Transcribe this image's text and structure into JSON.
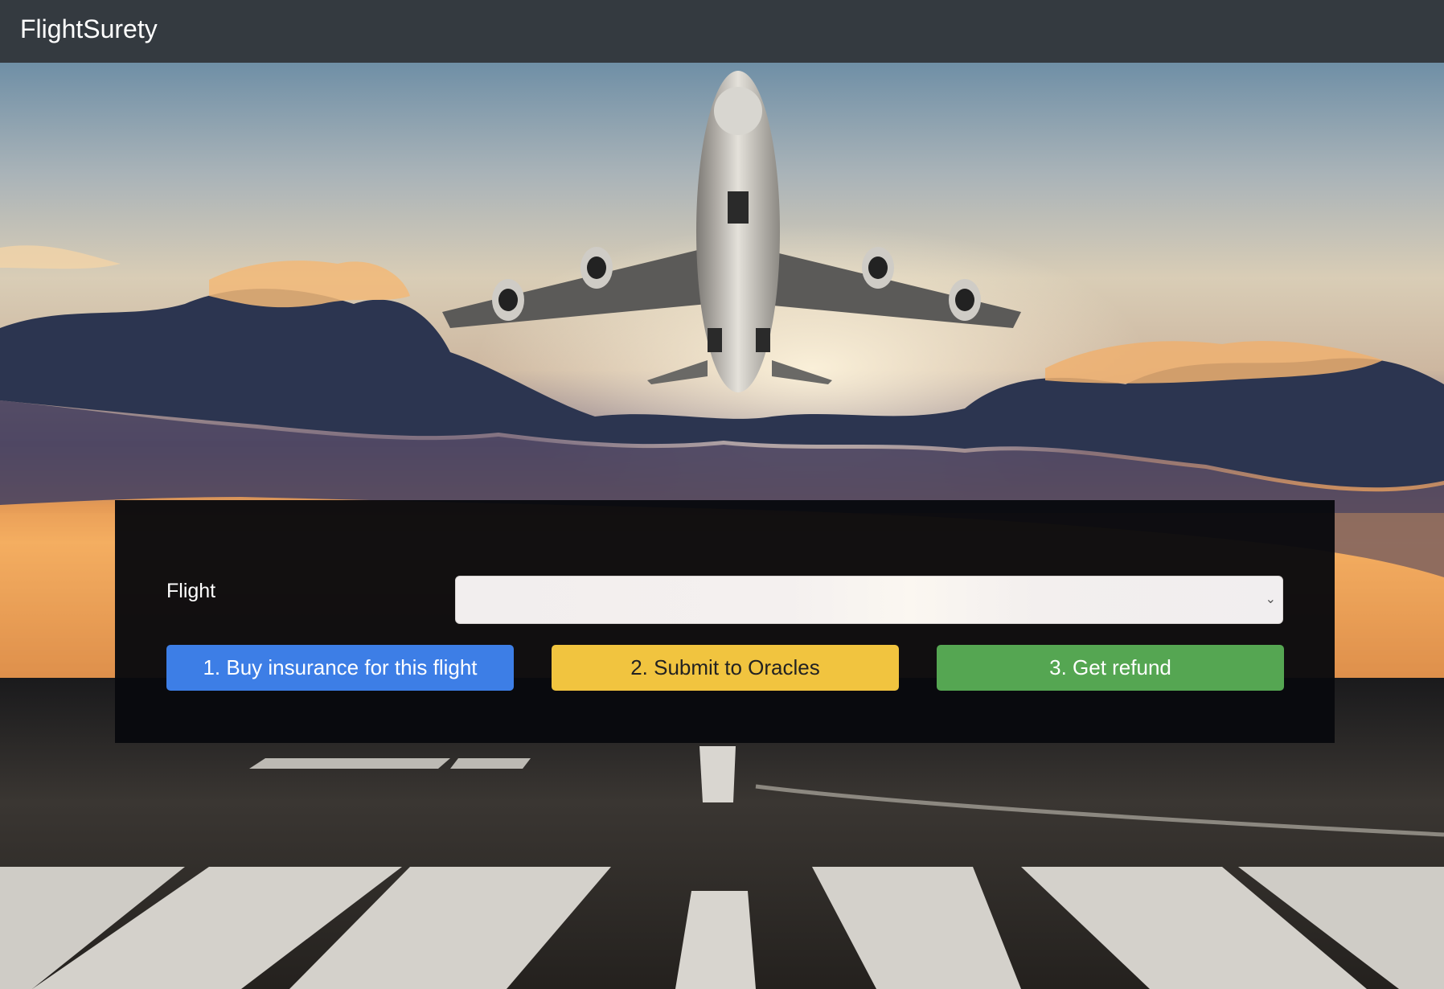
{
  "navbar": {
    "brand": "FlightSurety"
  },
  "form": {
    "flight_label": "Flight",
    "flight_select_value": "",
    "buy_button": "1. Buy insurance for this flight",
    "oracle_button": "2. Submit to Oracles",
    "refund_button": "3. Get refund"
  },
  "colors": {
    "navbar": "#343a40",
    "buy": "#3d7ee6",
    "oracle": "#f1c43f",
    "refund": "#55a652"
  },
  "icons": {
    "select_chevron": "chevron-down-icon"
  }
}
